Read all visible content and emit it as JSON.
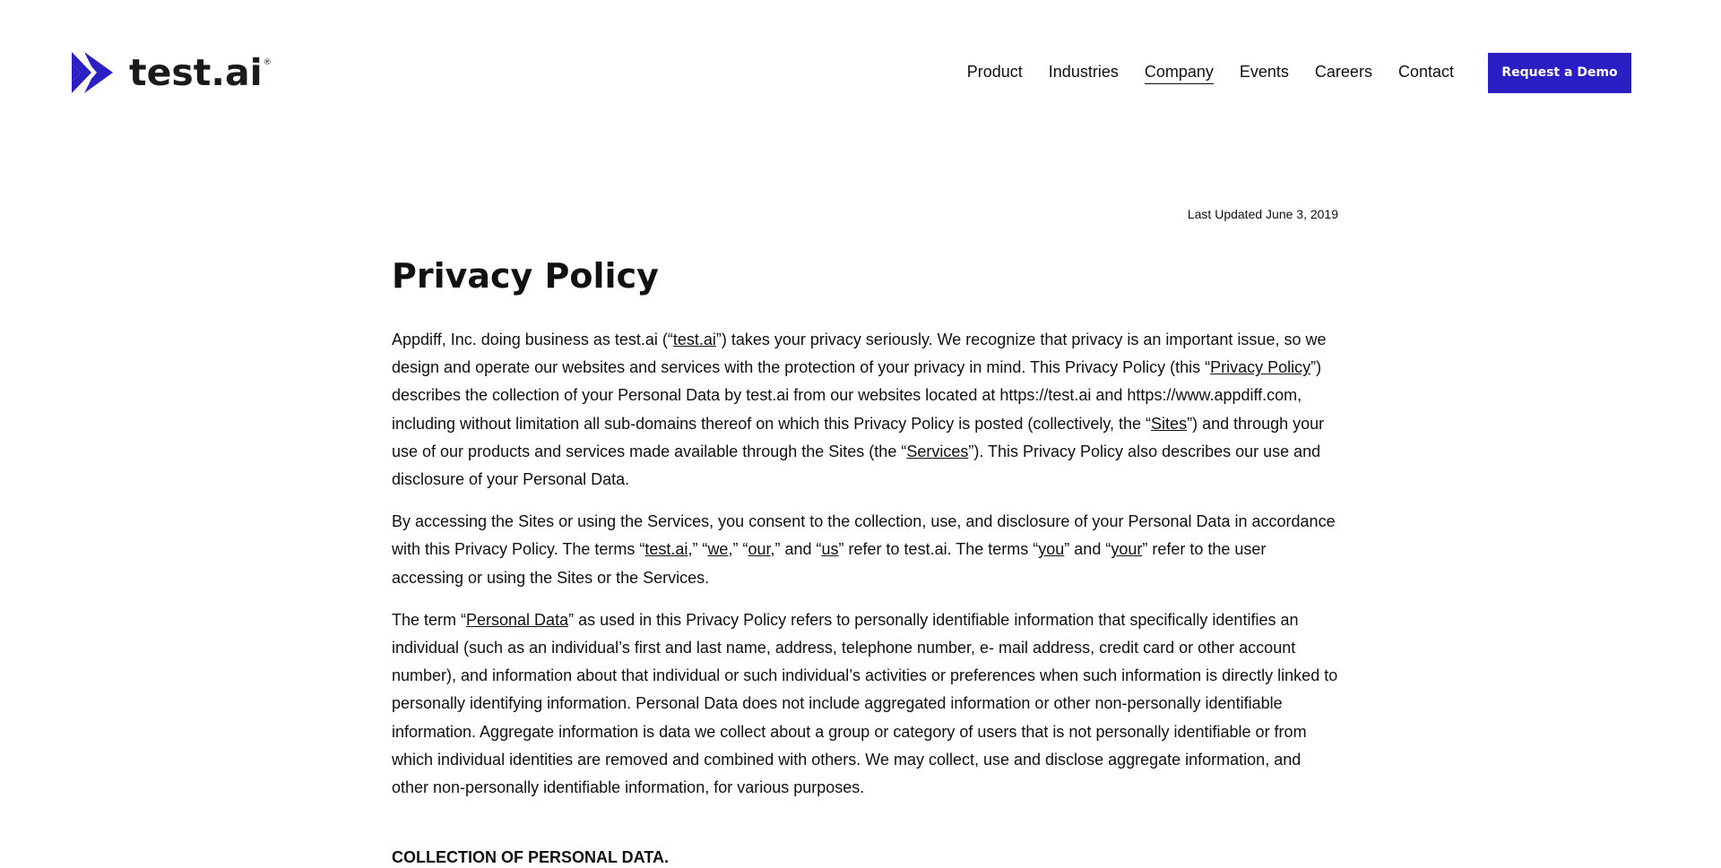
{
  "brand": {
    "name": "test.ai",
    "registered_mark": "®",
    "accent_color": "#2a1fc4"
  },
  "nav": {
    "items": [
      {
        "label": "Product"
      },
      {
        "label": "Industries"
      },
      {
        "label": "Company",
        "active": true
      },
      {
        "label": "Events"
      },
      {
        "label": "Careers"
      },
      {
        "label": "Contact"
      }
    ],
    "cta_label": "Request a Demo"
  },
  "page": {
    "last_updated": "Last Updated June 3, 2019",
    "title": "Privacy Policy",
    "paragraphs": [
      [
        {
          "text": "Appdiff, Inc. doing business as test.ai (“"
        },
        {
          "text": "test.ai",
          "u": true
        },
        {
          "text": "”) takes your privacy seriously. We recognize that privacy is an important issue, so we design and operate our websites and services with the protection of your privacy in mind. This Privacy Policy (this “"
        },
        {
          "text": "Privacy Policy",
          "u": true
        },
        {
          "text": "”) describes the collection of your Personal Data by test.ai from our websites located at https://test.ai and https://www.appdiff.com, including without limitation all sub-domains thereof on which this Privacy Policy is posted (collectively, the “"
        },
        {
          "text": "Sites",
          "u": true
        },
        {
          "text": "”) and through your use of our products and services made available through the Sites (the “"
        },
        {
          "text": "Services",
          "u": true
        },
        {
          "text": "”).  This Privacy Policy also describes our use and disclosure of your Personal Data."
        }
      ],
      [
        {
          "text": "By accessing the Sites or using the Services, you consent to the collection, use, and disclosure of your Personal Data in accordance with this Privacy Policy.  The terms “"
        },
        {
          "text": "test.ai",
          "u": true
        },
        {
          "text": ",” “"
        },
        {
          "text": "we",
          "u": true
        },
        {
          "text": ",” “"
        },
        {
          "text": "our",
          "u": true
        },
        {
          "text": ",” and “"
        },
        {
          "text": "us",
          "u": true
        },
        {
          "text": "” refer to test.ai. The terms “"
        },
        {
          "text": "you",
          "u": true
        },
        {
          "text": "” and “"
        },
        {
          "text": "your",
          "u": true
        },
        {
          "text": "” refer to the user accessing or using the Sites or the Services."
        }
      ],
      [
        {
          "text": "The term “"
        },
        {
          "text": "Personal Data",
          "u": true
        },
        {
          "text": "” as used in this Privacy Policy refers to personally identifiable information that specifically identifies an individual (such as an individual’s first and last name, address, telephone number, e- mail address, credit card or other account number), and information about that individual or such individual’s activities or preferences when such information is directly linked to personally identifying information.  Personal Data does not include aggregated information or other non-personally identifiable information.  Aggregate information is data we collect about a group or category of users that is not personally identifiable or from which individual identities are removed and combined with others.  We may collect, use and disclose aggregate information, and other non-personally identifiable information, for various purposes."
        }
      ]
    ],
    "section_heading": "COLLECTION OF PERSONAL DATA."
  }
}
